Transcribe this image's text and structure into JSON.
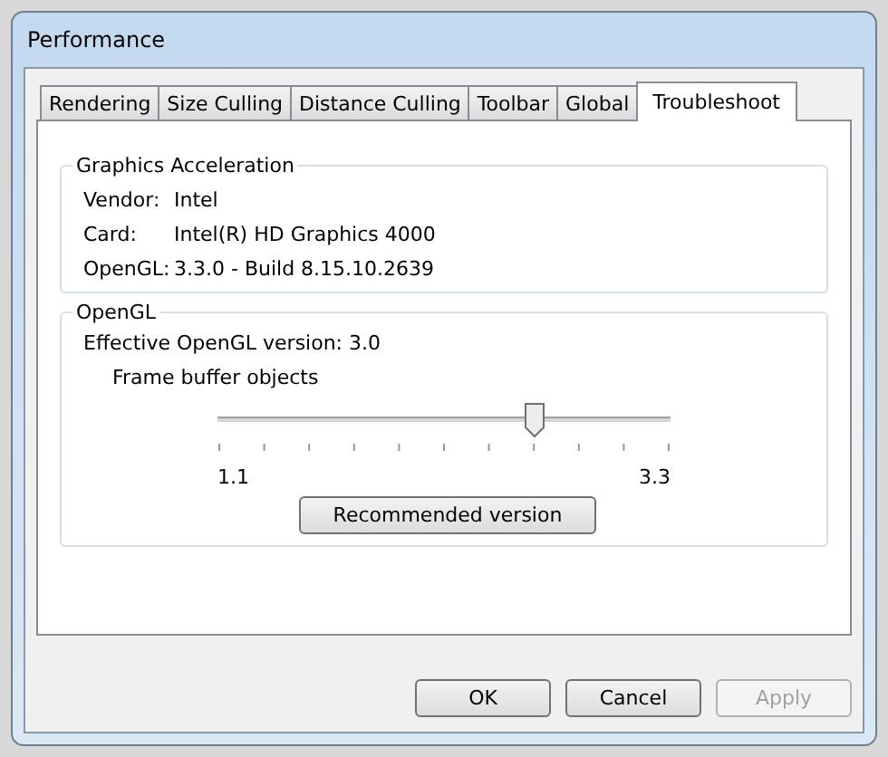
{
  "window": {
    "title": "Performance"
  },
  "tabs": [
    {
      "label": "Rendering",
      "selected": false
    },
    {
      "label": "Size Culling",
      "selected": false
    },
    {
      "label": "Distance Culling",
      "selected": false
    },
    {
      "label": "Toolbar",
      "selected": false
    },
    {
      "label": "Global",
      "selected": false
    },
    {
      "label": "Troubleshoot",
      "selected": true
    }
  ],
  "graphics_acceleration": {
    "title": "Graphics Acceleration",
    "rows": [
      {
        "label": "Vendor:",
        "value": "Intel"
      },
      {
        "label": "Card:",
        "value": "Intel(R) HD Graphics 4000"
      },
      {
        "label": "OpenGL:",
        "value": "3.3.0 - Build 8.15.10.2639"
      }
    ]
  },
  "opengl": {
    "title": "OpenGL",
    "effective_version": "Effective OpenGL version: 3.0",
    "feature": "Frame buffer objects",
    "slider": {
      "level": 0.7,
      "min_label": "1.1",
      "max_label": "3.3"
    },
    "button": "Recommended version"
  },
  "buttons": [
    {
      "label": "OK",
      "disabled": false
    },
    {
      "label": "Cancel",
      "disabled": false
    },
    {
      "label": "Apply",
      "disabled": true
    }
  ]
}
